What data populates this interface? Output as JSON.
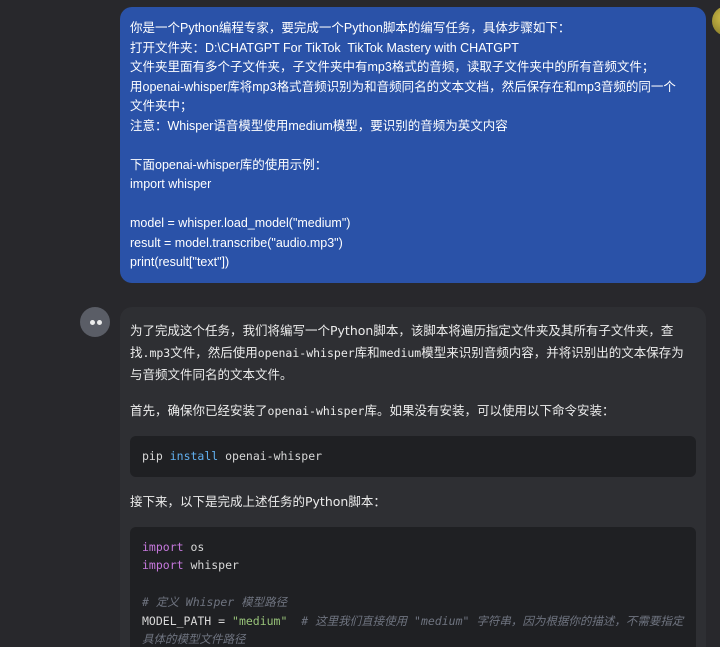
{
  "user_message": {
    "lines": [
      "你是一个Python编程专家，要完成一个Python脚本的编写任务，具体步骤如下：",
      "打开文件夹：D:\\CHATGPT For TikTok  TikTok Mastery with CHATGPT",
      "文件夹里面有多个子文件夹，子文件夹中有mp3格式的音频，读取子文件夹中的所有音频文件；",
      "用openai-whisper库将mp3格式音频识别为和音频同名的文本文档，然后保存在和mp3音频的同一个",
      "文件夹中；",
      "注意：Whisper语音模型使用medium模型，要识别的音频为英文内容",
      "",
      "下面openai-whisper库的使用示例：",
      "import whisper",
      "",
      "model = whisper.load_model(\"medium\")",
      "result = model.transcribe(\"audio.mp3\")",
      "print(result[\"text\"])"
    ]
  },
  "assistant_message": {
    "intro": {
      "part1": "为了完成这个任务，我们将编写一个Python脚本，该脚本将遍历指定文件夹及其所有子文件夹，查找",
      "code1": ".mp3",
      "part2": "文件，然后使用",
      "code2": "openai-whisper",
      "part3": "库和",
      "code3": "medium",
      "part4": "模型来识别音频内容，并将识别出的文本保存为与音频文件同名的文本文件。"
    },
    "install_intro": {
      "part1": "首先，确保你已经安装了",
      "code1": "openai-whisper",
      "part2": "库。如果没有安装，可以使用以下命令安装："
    },
    "install_cmd": {
      "cmd": "pip",
      "sub": "install",
      "pkg": "openai-whisper"
    },
    "script_intro": "接下来，以下是完成上述任务的Python脚本：",
    "script": {
      "kw_import": "import",
      "mod_os": " os",
      "mod_whisper": " whisper",
      "comment1": "# 定义 Whisper 模型路径",
      "var_name": "MODEL_PATH = ",
      "var_value": "\"medium\"",
      "comment2": "  # 这里我们直接使用 \"medium\" 字符串，因为根据你的描述，不需要指定具体的模型文件路径"
    }
  }
}
